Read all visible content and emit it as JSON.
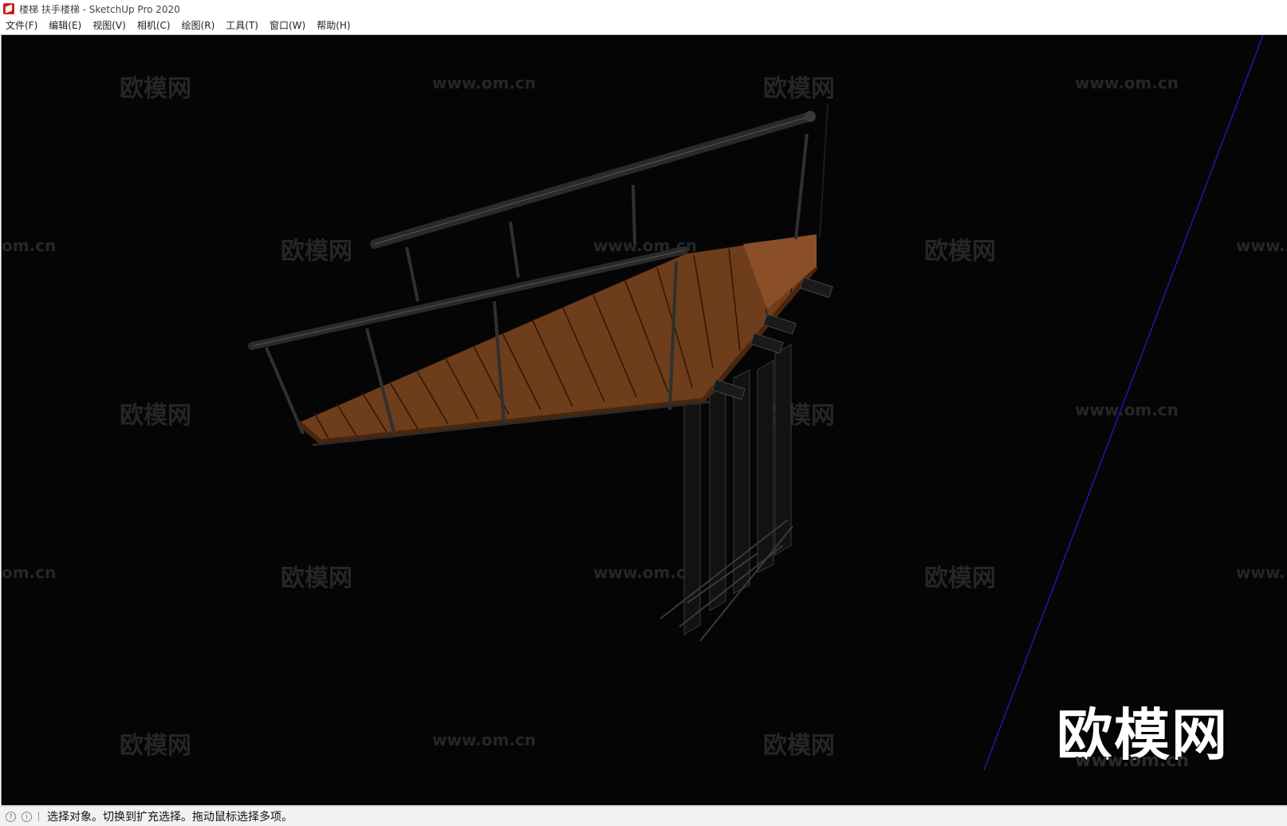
{
  "window": {
    "title": "楼梯 扶手楼梯 - SketchUp Pro 2020"
  },
  "menu": [
    {
      "label": "文件(F)"
    },
    {
      "label": "编辑(E)"
    },
    {
      "label": "视图(V)"
    },
    {
      "label": "相机(C)"
    },
    {
      "label": "绘图(R)"
    },
    {
      "label": "工具(T)"
    },
    {
      "label": "窗口(W)"
    },
    {
      "label": "帮助(H)"
    }
  ],
  "watermarks": {
    "logo": "欧模网",
    "url": "www.om.cn",
    "url_partial_left": "om.cn",
    "url_partial_right": "www."
  },
  "status": {
    "text": "选择对象。切换到扩充选择。拖动鼠标选择多项。"
  },
  "colors": {
    "viewport_bg": "#050505",
    "wood": "#7a4520",
    "axis_blue": "#1a1aa8",
    "app_icon": "#c8201f"
  },
  "icons": {
    "app": "sketchup-icon",
    "geo": "geo-location-icon",
    "credits": "credits-icon"
  }
}
